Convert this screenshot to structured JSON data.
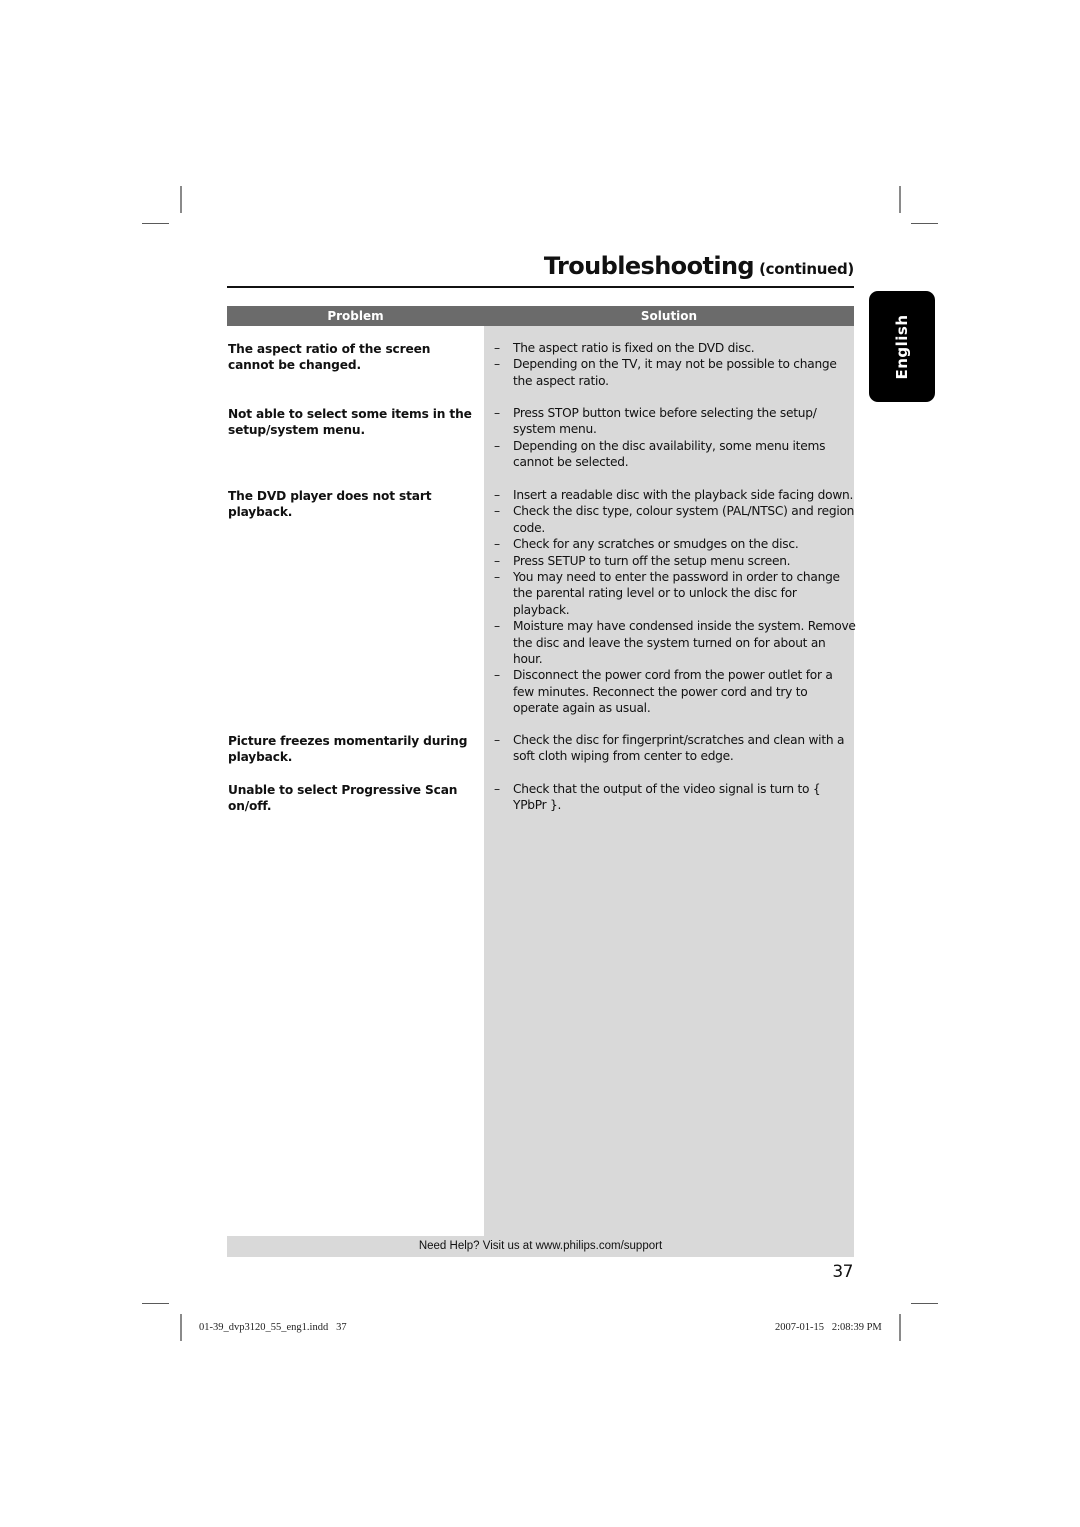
{
  "page": {
    "title": "Troubleshooting",
    "title_suffix": "(continued)",
    "language_tab": "English",
    "page_number": "37"
  },
  "table": {
    "headers": {
      "problem": "Problem",
      "solution": "Solution"
    },
    "rows": [
      {
        "problem": "The aspect ratio of the screen cannot be changed.",
        "solutions": [
          "The aspect ratio is fixed on the DVD disc.",
          "Depending on the TV, it may not be possible to change the aspect ratio."
        ]
      },
      {
        "problem": "Not able to select some items in the setup/system menu.",
        "solutions": [
          "Press STOP button twice before selecting the setup/ system menu.",
          "Depending on the disc availability, some menu items cannot be selected."
        ]
      },
      {
        "problem": "The DVD player does not start playback.",
        "solutions": [
          "Insert a readable disc with the playback side facing down.",
          "Check the disc type, colour system (PAL/NTSC) and region code.",
          "Check for any scratches or smudges on the disc.",
          "Press SETUP to turn off the setup menu screen.",
          "You may need to enter the password in order to change the parental rating level or to unlock the disc for playback.",
          "Moisture may have condensed inside the system. Remove the disc and leave the system turned on for about an hour.",
          "Disconnect the power cord from the power outlet for a few minutes. Reconnect the power cord and try to operate again as usual."
        ]
      },
      {
        "problem": "Picture freezes momentarily during playback.",
        "solutions": [
          "Check the disc for fingerprint/scratches and clean with a soft cloth wiping from center to edge."
        ]
      },
      {
        "problem": "Unable to select Progressive Scan on/off.",
        "solutions": [
          "Check that the output of the video signal is turn to { YPbPr }."
        ]
      }
    ],
    "dash_glyph": "–"
  },
  "footer": {
    "help_text": "Need Help? Visit us at www.philips.com/support"
  },
  "print_slug": {
    "file": "01-39_dvp3120_55_eng1.indd   37",
    "timestamp": "2007-01-15   2:08:39 PM"
  },
  "colors": {
    "header_bar": "#6b6b6b",
    "solution_column": "#d9d9d9",
    "language_tab": "#000000",
    "text": "#111111"
  }
}
